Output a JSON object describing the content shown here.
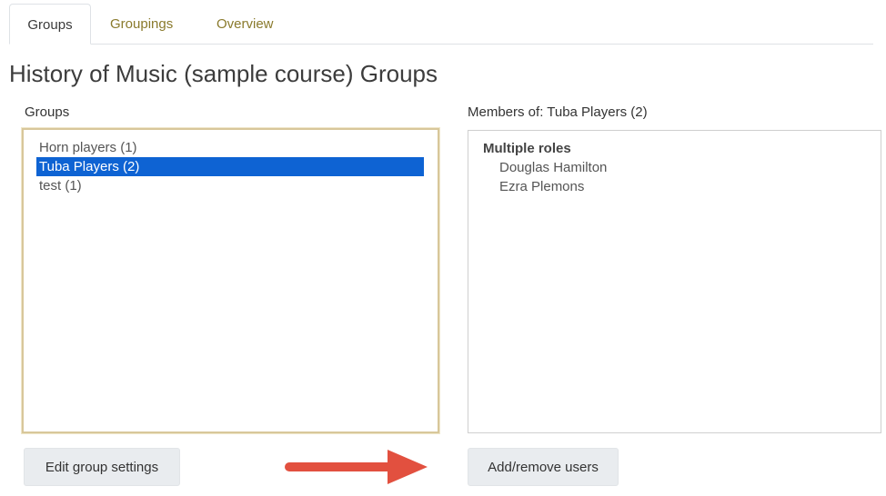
{
  "tabs": [
    {
      "label": "Groups",
      "active": true
    },
    {
      "label": "Groupings",
      "active": false
    },
    {
      "label": "Overview",
      "active": false
    }
  ],
  "page_title": "History of Music (sample course) Groups",
  "groups": {
    "label": "Groups",
    "options": [
      {
        "label": "Horn players (1)",
        "selected": false
      },
      {
        "label": "Tuba Players (2)",
        "selected": true
      },
      {
        "label": "test (1)",
        "selected": false
      }
    ]
  },
  "members": {
    "label": "Members of: Tuba Players (2)",
    "role_heading": "Multiple roles",
    "names": [
      "Douglas Hamilton",
      "Ezra Plemons"
    ]
  },
  "buttons": {
    "edit_label": "Edit group settings",
    "add_remove_label": "Add/remove users"
  },
  "colors": {
    "tab_link": "#8a7a2c",
    "selected_option": "#0e63d3",
    "select_border": "#d8c79a",
    "arrow": "#e2503f",
    "button_bg": "#e9ecef"
  },
  "icons": {
    "annotation": "right-arrow-icon"
  }
}
